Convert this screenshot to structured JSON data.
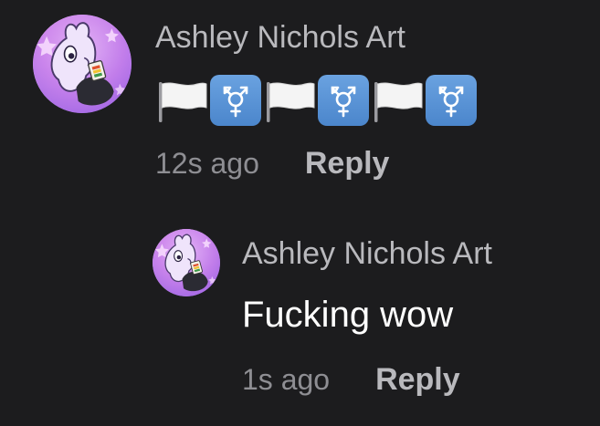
{
  "comments": [
    {
      "author": "Ashley Nichols Art",
      "reactions": [
        "white-flag",
        "transgender-symbol",
        "white-flag",
        "transgender-symbol",
        "white-flag",
        "transgender-symbol"
      ],
      "timestamp": "12s ago",
      "reply_label": "Reply"
    },
    {
      "author": "Ashley Nichols Art",
      "text": "Fucking wow",
      "timestamp": "1s ago",
      "reply_label": "Reply"
    }
  ],
  "colors": {
    "background": "#1c1c1e",
    "author": "#b9b9bd",
    "message": "#ffffff",
    "timestamp": "#8e8e93",
    "tile": "#5b95d8"
  }
}
